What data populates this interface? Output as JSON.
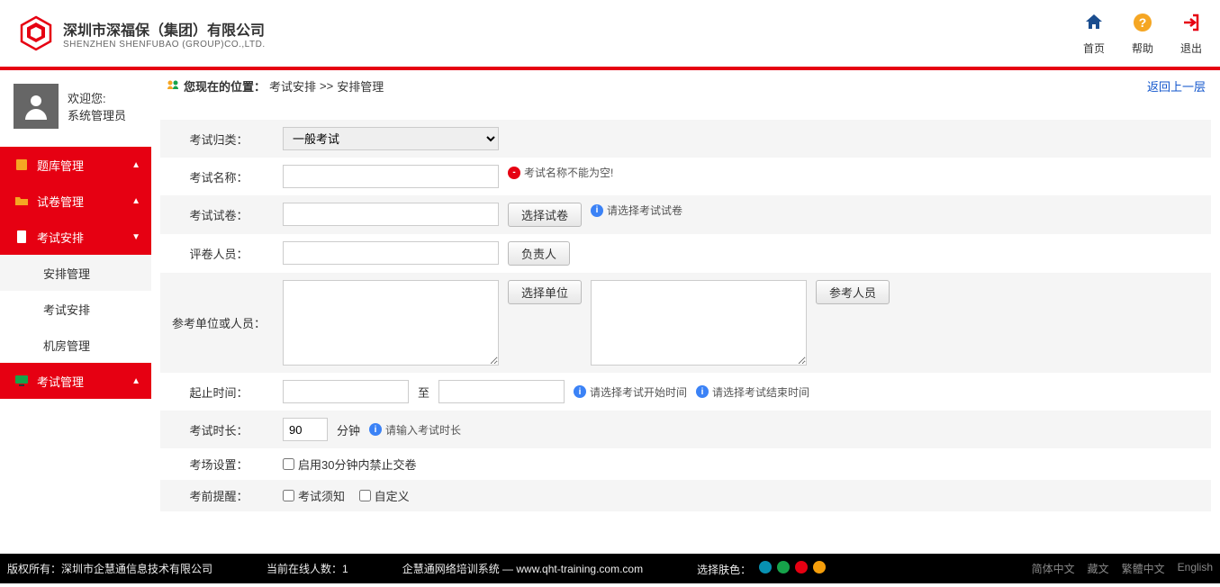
{
  "header": {
    "company_name": "深圳市深福保（集团）有限公司",
    "company_sub": "SHENZHEN SHENFUBAO (GROUP)CO.,LTD.",
    "actions": {
      "home": "首页",
      "help": "帮助",
      "logout": "退出"
    },
    "colors": {
      "home": "#1a4d8f",
      "help": "#f5a623",
      "logout": "#e60012"
    }
  },
  "welcome": {
    "greet": "欢迎您:",
    "user": "系统管理员"
  },
  "nav": {
    "items": [
      {
        "label": "题库管理"
      },
      {
        "label": "试卷管理"
      },
      {
        "label": "考试安排"
      },
      {
        "label": "考试管理"
      }
    ],
    "subs": [
      {
        "label": "安排管理"
      },
      {
        "label": "考试安排"
      },
      {
        "label": "机房管理"
      }
    ]
  },
  "breadcrumb": {
    "location_label": "您现在的位置：",
    "part1": "考试安排",
    "sep": "  >>  ",
    "part2": "安排管理",
    "back": "返回上一层"
  },
  "form": {
    "labels": {
      "category": "考试归类：",
      "name": "考试名称：",
      "paper": "考试试卷：",
      "reviewer": "评卷人员：",
      "units": "参考单位或人员：",
      "timerange": "起止时间：",
      "to": "至",
      "duration": "考试时长：",
      "minutes": "分钟",
      "room": "考场设置：",
      "remind": "考前提醒："
    },
    "values": {
      "category_selected": "一般考试",
      "duration": "90"
    },
    "buttons": {
      "select_paper": "选择试卷",
      "owner": "负责人",
      "select_unit": "选择单位",
      "select_person": "参考人员"
    },
    "hints": {
      "name_empty": "考试名称不能为空!",
      "select_paper": "请选择考试试卷",
      "start_time": "请选择考试开始时间",
      "end_time": "请选择考试结束时间",
      "input_duration": "请输入考试时长"
    },
    "checkboxes": {
      "forbid30": "启用30分钟内禁止交卷",
      "notice": "考试须知",
      "custom": "自定义"
    }
  },
  "footer": {
    "copyright": "版权所有：深圳市企慧通信息技术有限公司",
    "online_label": "当前在线人数：",
    "online_count": "1",
    "system": "企慧通网络培训系统 — www.qht-training.com.com",
    "skin_label": "选择肤色：",
    "langs": {
      "sc": "简体中文",
      "tb": "藏文",
      "tc": "繁體中文",
      "en": "English"
    },
    "skin_colors": [
      "#0891b2",
      "#16a34a",
      "#e60012",
      "#f59e0b"
    ]
  }
}
